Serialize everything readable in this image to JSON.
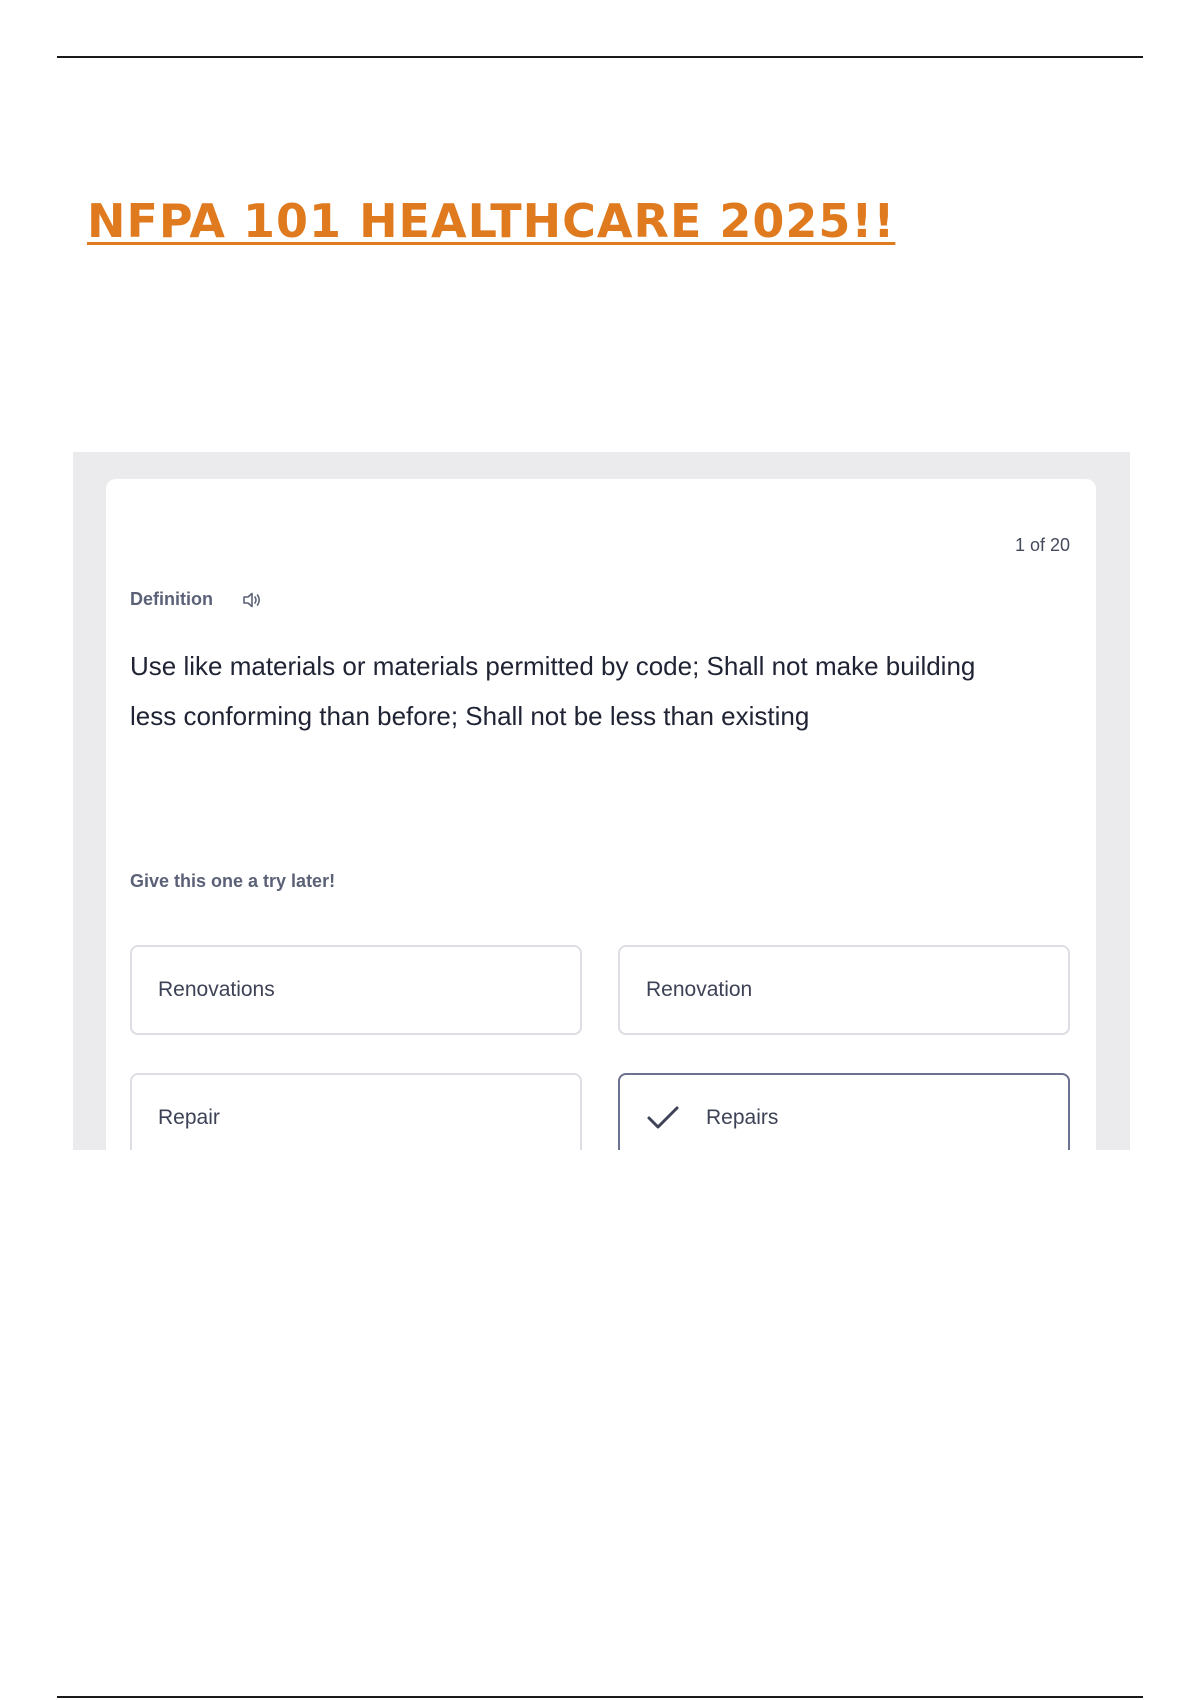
{
  "document": {
    "title": "NFPA 101 HEALTHCARE 2025!!"
  },
  "flashcard": {
    "counter": "1 of 20",
    "term_label": "Definition",
    "speaker_icon": "speaker-icon",
    "definition": "Use like materials or materials permitted by code; Shall not make building less conforming than before; Shall not be less than existing",
    "hint": "Give this one a try later!",
    "options": [
      {
        "label": "Renovations",
        "selected": false
      },
      {
        "label": "Renovation",
        "selected": false
      },
      {
        "label": "Repair",
        "selected": false
      },
      {
        "label": "Repairs",
        "selected": true,
        "icon": "check-icon"
      }
    ]
  },
  "colors": {
    "title_orange": "#e07a1f",
    "frame_gray": "#ebebee",
    "text_dark": "#1f2333",
    "text_muted": "#5b6177",
    "selected_border": "#6b7190"
  }
}
